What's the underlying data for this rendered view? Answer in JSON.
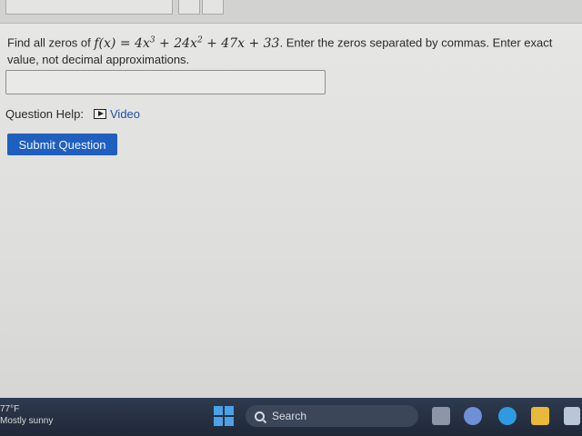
{
  "question": {
    "prefix": "Find all zeros of ",
    "function_name": "f(x)",
    "equals": " = ",
    "term1_coef": "4x",
    "term1_exp": "3",
    "plus1": " + ",
    "term2_coef": "24x",
    "term2_exp": "2",
    "rest": " + 47x + 33",
    "suffix": ". Enter the zeros separated by commas. Enter exact value, not decimal approximations."
  },
  "answer": {
    "value": "",
    "placeholder": ""
  },
  "help": {
    "label": "Question Help:",
    "video_label": "Video"
  },
  "submit_label": "Submit Question",
  "taskbar": {
    "temperature": "77°F",
    "weather": "Mostly sunny",
    "search_label": "Search"
  },
  "colors": {
    "accent": "#1f5fbf",
    "link": "#1f4fa8",
    "taskbar": "#1f2837"
  }
}
